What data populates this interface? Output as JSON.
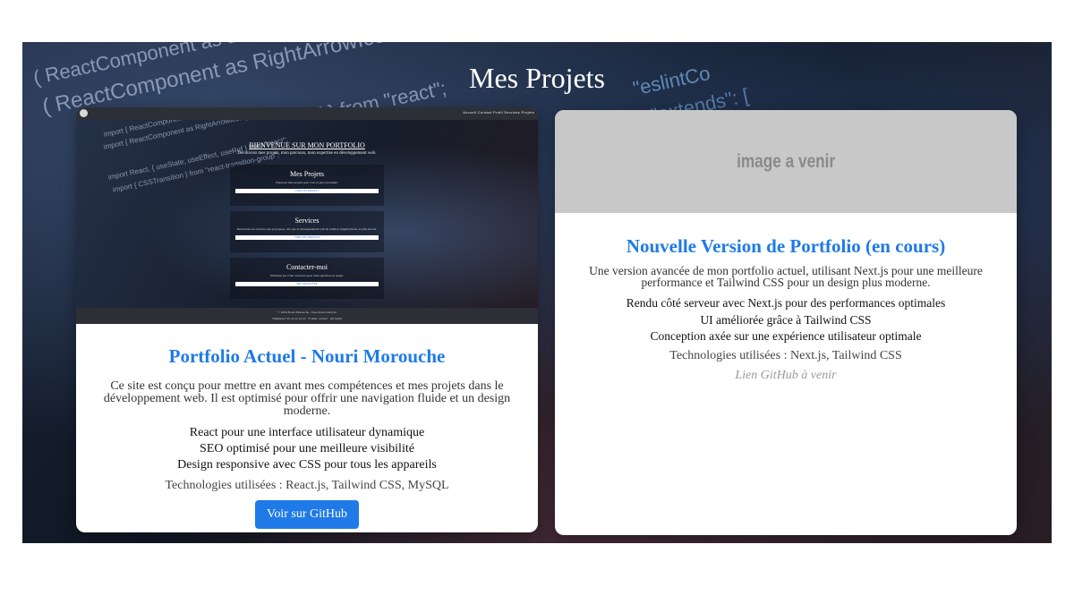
{
  "page": {
    "title": "Mes Projets"
  },
  "background_code": [
    "( ReactComponent as BoltIco",
    "( ReactComponent as RightArrowIcon } fro",
    "Ref } from \"react\";",
    "\"eslintCo",
    "\"extends\": ["
  ],
  "project1": {
    "title": "Portfolio Actuel - Nouri Morouche",
    "description": "Ce site est conçu pour mettre en avant mes compétences et mes projets dans le développement web. Il est optimisé pour offrir une navigation fluide et un design moderne.",
    "features": [
      "React pour une interface utilisateur dynamique",
      "SEO optimisé pour une meilleure visibilité",
      "Design responsive avec CSS pour tous les appareils"
    ],
    "technologies": "Technologies utilisées : React.js, Tailwind CSS, MySQL",
    "github_button": "Voir sur GitHub",
    "thumbnail": {
      "nav_links": "Accueil  Contact  Profil  Services  Projets",
      "heading": "BIENVENUE SUR MON PORTFOLIO",
      "subheading": "Découvrez mes projets, mon parcours, mon expertise en développement web.",
      "code_lines": [
        "import { ReactComponent as BoltIcon } from",
        "import { ReactComponent as RightArrowIcon } from",
        "import React, { useState, useEffect, useRef } from \"react\";",
        "import { CSSTransition } from \"react-transition-group\";"
      ],
      "sections": [
        {
          "title": "Mes Projets",
          "text": "Explorez mes projets pour voir ce que j'ai réalisé.",
          "button": "VOIR LES PROJETS"
        },
        {
          "title": "Services",
          "text": "Découvrez les services que je propose, tels que le développement web & création d'applications, et plus encore.",
          "button": "VOIR LES SERVICES"
        },
        {
          "title": "Contacter-moi",
          "text": "N'hésitez pas à me contacter pour toute question ou projet.",
          "button": "ME CONTACTER"
        }
      ],
      "footer_line1": "© 2024 Nouri Morouche - Tous droits réservés",
      "footer_line2": "Téléphone: 0x xx xx xx xx   ·   E-mail: contact   ·   All rights"
    }
  },
  "project2": {
    "image_placeholder": "image a venir",
    "title": "Nouvelle Version de Portfolio (en cours)",
    "description": "Une version avancée de mon portfolio actuel, utilisant Next.js pour une meilleure performance et Tailwind CSS pour un design plus moderne.",
    "features": [
      "Rendu côté serveur avec Next.js pour des performances optimales",
      "UI améliorée grâce à Tailwind CSS",
      "Conception axée sur une expérience utilisateur optimale"
    ],
    "technologies": "Technologies utilisées : Next.js, Tailwind CSS",
    "github_soon": "Lien GitHub à venir"
  }
}
